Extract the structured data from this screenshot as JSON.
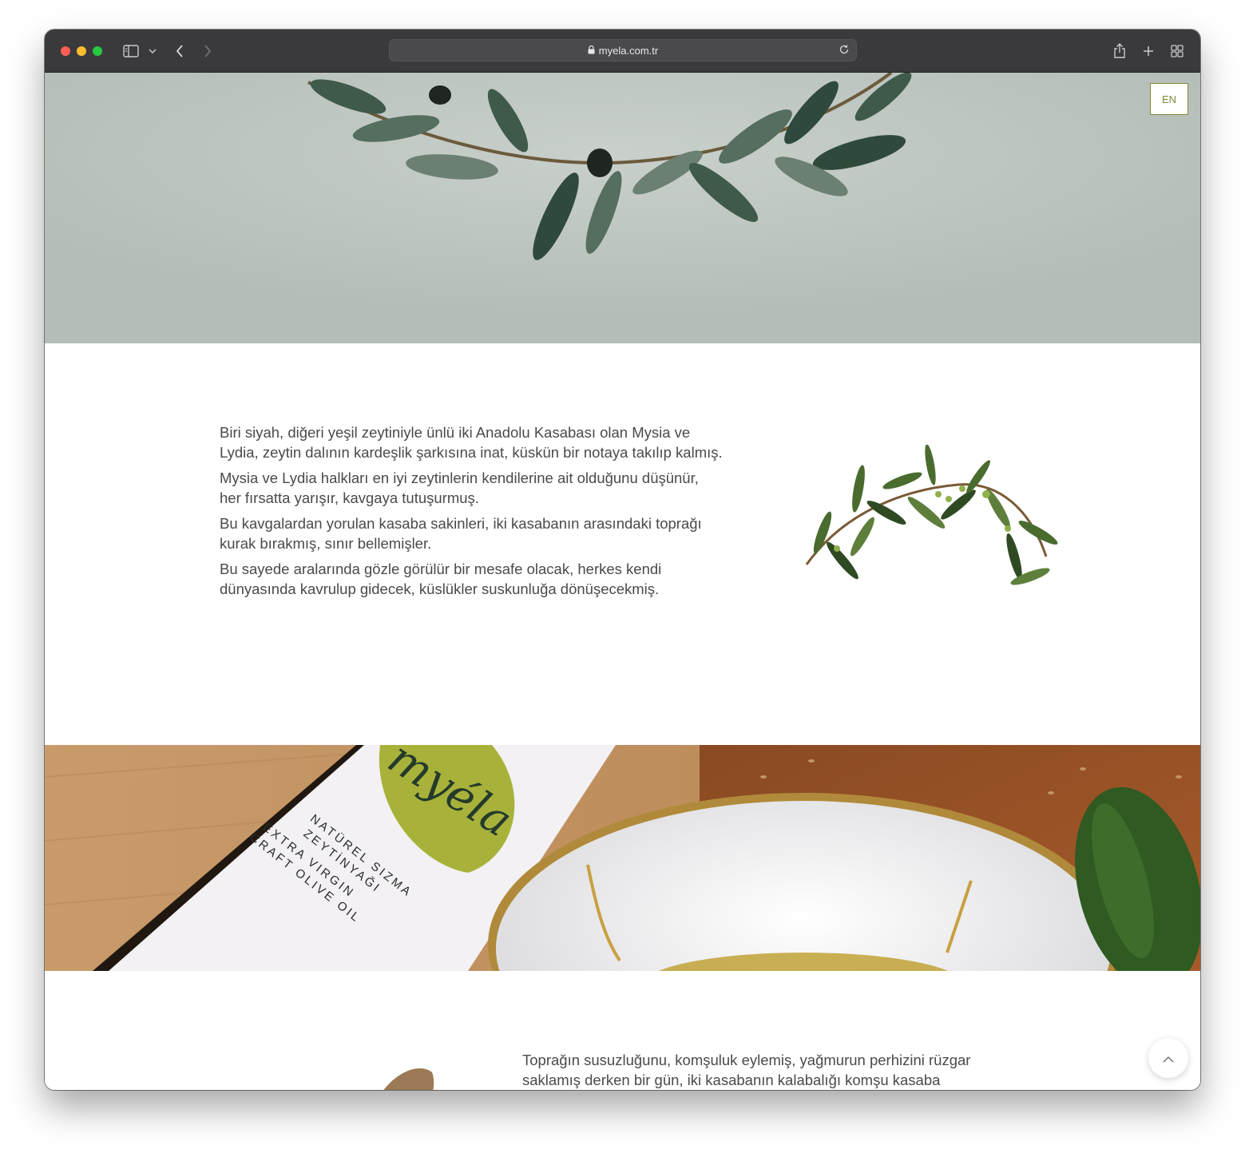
{
  "browser": {
    "url": "myela.com.tr"
  },
  "header": {
    "lang_button": "EN"
  },
  "story": {
    "paragraphs": [
      "Biri siyah, diğeri yeşil zeytiniyle ünlü iki Anadolu Kasabası olan Mysia ve Lydia, zeytin dalının kardeşlik şarkısına inat, küskün bir notaya takılıp kalmış.",
      "Mysia ve Lydia halkları en iyi zeytinlerin kendilerine ait olduğunu düşünür, her fırsatta yarışır, kavgaya tutuşurmuş.",
      "Bu kavgalardan yorulan kasaba sakinleri, iki kasabanın arasındaki toprağı kurak bırakmış, sınır bellemişler.",
      "Bu sayede aralarında gözle görülür bir mesafe olacak, herkes kendi dünyasında kavrulup gidecek, küslükler suskunluğa dönüşecekmiş."
    ]
  },
  "product": {
    "logo_text": "myéla",
    "label_lines": [
      "NATÜREL SIZMA",
      "ZEYTİNYAĞI",
      "EXTRA VIRGIN",
      "CRAFT OLIVE OIL"
    ]
  },
  "story2": {
    "paragraph": "Toprağın susuzluğunu, komşuluk eylemiş, yağmurun perhizini rüzgar saklamış derken bir gün, iki kasabanın kalabalığı komşu kasaba"
  },
  "icons": {
    "lock": "lock-icon",
    "reload": "reload-icon",
    "scroll_top": "chevron-up-icon"
  },
  "colors": {
    "hero_bg": "#b4bdb7",
    "accent": "#7d8b3a",
    "text": "#4a4a4a"
  }
}
